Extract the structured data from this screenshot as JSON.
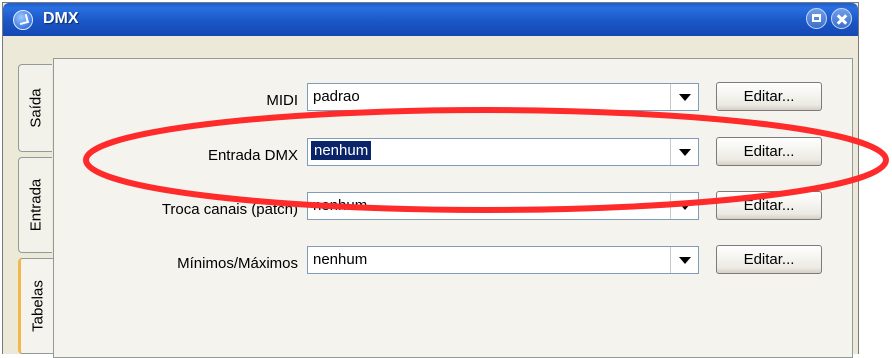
{
  "window": {
    "title": "DMX"
  },
  "tabs": [
    {
      "label": "Saída",
      "active": false
    },
    {
      "label": "Entrada",
      "active": false
    },
    {
      "label": "Tabelas",
      "active": true
    }
  ],
  "rows": [
    {
      "label": "MIDI",
      "value": "padrao",
      "button": "Editar..."
    },
    {
      "label": "Entrada DMX",
      "value": "nenhum",
      "button": "Editar...",
      "selected": true
    },
    {
      "label": "Troca canais (patch)",
      "value": "nenhum",
      "button": "Editar..."
    },
    {
      "label": "Mínimos/Máximos",
      "value": "nenhum",
      "button": "Editar..."
    }
  ],
  "annotation": {
    "color": "#ff2a2a",
    "shape": "ellipse",
    "target": "Entrada DMX"
  }
}
